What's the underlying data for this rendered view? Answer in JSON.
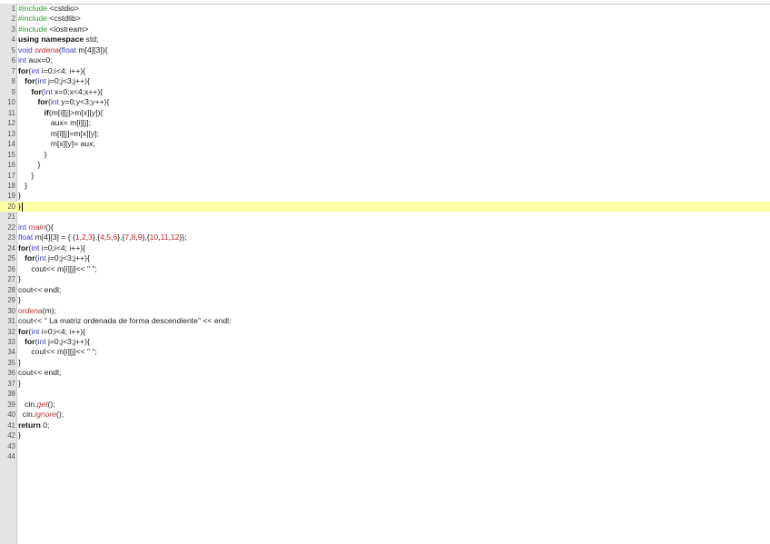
{
  "editor": {
    "current_line": 20,
    "lines": [
      {
        "n": "1",
        "tokens": [
          [
            "pp",
            "#include"
          ],
          [
            "id",
            " <cstdio>"
          ]
        ]
      },
      {
        "n": "2",
        "tokens": [
          [
            "pp",
            "#include"
          ],
          [
            "id",
            " <cstdlib>"
          ]
        ]
      },
      {
        "n": "3",
        "tokens": [
          [
            "pp",
            "#include"
          ],
          [
            "id",
            " <iostream>"
          ]
        ]
      },
      {
        "n": "4",
        "tokens": [
          [
            "kw",
            "using"
          ],
          [
            "id",
            " "
          ],
          [
            "kw",
            "namespace"
          ],
          [
            "id",
            " std;"
          ]
        ]
      },
      {
        "n": "5",
        "tokens": [
          [
            "ty",
            "void"
          ],
          [
            "id",
            " "
          ],
          [
            "fn",
            "ordena"
          ],
          [
            "op",
            "("
          ],
          [
            "ty",
            "float"
          ],
          [
            "id",
            " m[4][3]){"
          ]
        ]
      },
      {
        "n": "6",
        "tokens": [
          [
            "ty",
            "int"
          ],
          [
            "id",
            " aux=0;"
          ]
        ]
      },
      {
        "n": "7",
        "tokens": [
          [
            "kw",
            "for"
          ],
          [
            "op",
            "("
          ],
          [
            "ty",
            "int"
          ],
          [
            "id",
            " i=0;i<4; i++){"
          ]
        ]
      },
      {
        "n": "8",
        "tokens": [
          [
            "id",
            "   "
          ],
          [
            "kw",
            "for"
          ],
          [
            "op",
            "("
          ],
          [
            "ty",
            "int"
          ],
          [
            "id",
            " j=0;j<3;j++){"
          ]
        ]
      },
      {
        "n": "9",
        "tokens": [
          [
            "id",
            "      "
          ],
          [
            "kw",
            "for"
          ],
          [
            "op",
            "("
          ],
          [
            "ty",
            "int"
          ],
          [
            "id",
            " x=0;x<4;x++){"
          ]
        ]
      },
      {
        "n": "10",
        "tokens": [
          [
            "id",
            "         "
          ],
          [
            "kw",
            "for"
          ],
          [
            "op",
            "("
          ],
          [
            "ty",
            "int"
          ],
          [
            "id",
            " y=0;y<3;y++){"
          ]
        ]
      },
      {
        "n": "11",
        "tokens": [
          [
            "id",
            "            "
          ],
          [
            "kw",
            "if"
          ],
          [
            "id",
            "(m[i][j]>m[x][y]){"
          ]
        ]
      },
      {
        "n": "12",
        "tokens": [
          [
            "id",
            "               aux= m[i][j];"
          ]
        ]
      },
      {
        "n": "13",
        "tokens": [
          [
            "id",
            "               m[i][j]=m[x][y];"
          ]
        ]
      },
      {
        "n": "14",
        "tokens": [
          [
            "id",
            "               m[x][y]= aux;"
          ]
        ]
      },
      {
        "n": "15",
        "tokens": [
          [
            "id",
            "            }"
          ]
        ]
      },
      {
        "n": "16",
        "tokens": [
          [
            "id",
            "         }"
          ]
        ]
      },
      {
        "n": "17",
        "tokens": [
          [
            "id",
            "      }"
          ]
        ]
      },
      {
        "n": "18",
        "tokens": [
          [
            "id",
            "   }"
          ]
        ]
      },
      {
        "n": "19",
        "tokens": [
          [
            "id",
            "}"
          ]
        ]
      },
      {
        "n": "20",
        "tokens": [
          [
            "id",
            "}"
          ]
        ]
      },
      {
        "n": "21",
        "tokens": []
      },
      {
        "n": "22",
        "tokens": [
          [
            "ty",
            "int"
          ],
          [
            "id",
            " "
          ],
          [
            "fn",
            "main"
          ],
          [
            "id",
            "(){"
          ]
        ]
      },
      {
        "n": "23",
        "tokens": [
          [
            "ty",
            "float"
          ],
          [
            "id",
            " m[4][3] = { {"
          ],
          [
            "num",
            "1"
          ],
          [
            "id",
            ","
          ],
          [
            "num",
            "2"
          ],
          [
            "id",
            ","
          ],
          [
            "num",
            "3"
          ],
          [
            "id",
            "},{"
          ],
          [
            "num",
            "4"
          ],
          [
            "id",
            ","
          ],
          [
            "num",
            "5"
          ],
          [
            "id",
            ","
          ],
          [
            "num",
            "6"
          ],
          [
            "id",
            "},{"
          ],
          [
            "num",
            "7"
          ],
          [
            "id",
            ","
          ],
          [
            "num",
            "8"
          ],
          [
            "id",
            ","
          ],
          [
            "num",
            "9"
          ],
          [
            "id",
            "},{"
          ],
          [
            "num",
            "10"
          ],
          [
            "id",
            ","
          ],
          [
            "num",
            "11"
          ],
          [
            "id",
            ","
          ],
          [
            "num",
            "12"
          ],
          [
            "id",
            "}};"
          ]
        ]
      },
      {
        "n": "24",
        "tokens": [
          [
            "kw",
            "for"
          ],
          [
            "op",
            "("
          ],
          [
            "ty",
            "int"
          ],
          [
            "id",
            " i=0;i<4; i++){"
          ]
        ]
      },
      {
        "n": "25",
        "tokens": [
          [
            "id",
            "   "
          ],
          [
            "kw",
            "for"
          ],
          [
            "op",
            "("
          ],
          [
            "ty",
            "int"
          ],
          [
            "id",
            " j=0;j<3;j++){"
          ]
        ]
      },
      {
        "n": "26",
        "tokens": [
          [
            "id",
            "      cout<< m[i][j]<< \" \";"
          ]
        ]
      },
      {
        "n": "27",
        "tokens": [
          [
            "id",
            "}"
          ]
        ]
      },
      {
        "n": "28",
        "tokens": [
          [
            "id",
            "cout<< endl;"
          ]
        ]
      },
      {
        "n": "29",
        "tokens": [
          [
            "id",
            "}"
          ]
        ]
      },
      {
        "n": "30",
        "tokens": [
          [
            "fn",
            "ordena"
          ],
          [
            "id",
            "(m);"
          ]
        ]
      },
      {
        "n": "31",
        "tokens": [
          [
            "id",
            "cout<< \" La matriz ordenada de forma descendiente\" << endl;"
          ]
        ]
      },
      {
        "n": "32",
        "tokens": [
          [
            "kw",
            "for"
          ],
          [
            "op",
            "("
          ],
          [
            "ty",
            "int"
          ],
          [
            "id",
            " i=0;i<4; i++){"
          ]
        ]
      },
      {
        "n": "33",
        "tokens": [
          [
            "id",
            "   "
          ],
          [
            "kw",
            "for"
          ],
          [
            "op",
            "("
          ],
          [
            "ty",
            "int"
          ],
          [
            "id",
            " j=0;j<3;j++){"
          ]
        ]
      },
      {
        "n": "34",
        "tokens": [
          [
            "id",
            "      cout<< m[i][j]<< \" \";"
          ]
        ]
      },
      {
        "n": "35",
        "tokens": [
          [
            "id",
            "}"
          ]
        ]
      },
      {
        "n": "36",
        "tokens": [
          [
            "id",
            "cout<< endl;"
          ]
        ]
      },
      {
        "n": "37",
        "tokens": [
          [
            "id",
            "}"
          ]
        ]
      },
      {
        "n": "38",
        "tokens": []
      },
      {
        "n": "39",
        "tokens": [
          [
            "id",
            "   cin."
          ],
          [
            "fn",
            "get"
          ],
          [
            "id",
            "();"
          ]
        ]
      },
      {
        "n": "40",
        "tokens": [
          [
            "id",
            "  cin."
          ],
          [
            "fn",
            "ignore"
          ],
          [
            "id",
            "();"
          ]
        ]
      },
      {
        "n": "41",
        "tokens": [
          [
            "kw",
            "return"
          ],
          [
            "id",
            " 0;"
          ]
        ]
      },
      {
        "n": "42",
        "tokens": [
          [
            "id",
            "}"
          ]
        ]
      },
      {
        "n": "43",
        "tokens": []
      },
      {
        "n": "44",
        "tokens": []
      }
    ]
  }
}
